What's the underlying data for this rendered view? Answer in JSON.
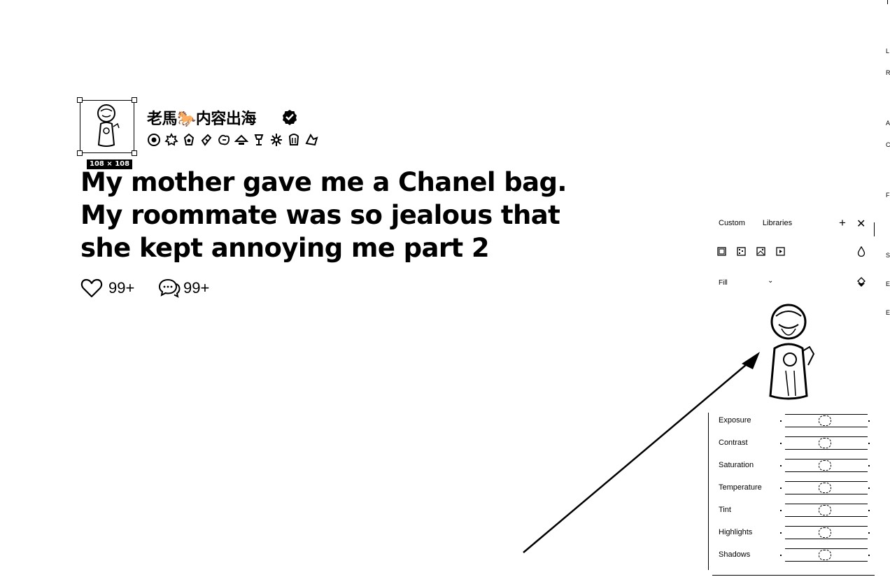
{
  "post": {
    "author_name": "老馬🐎内容出海",
    "size_badge": "108 × 108",
    "title": "My mother gave me a Chanel bag. My roommate was so jealous that she kept annoying me part 2",
    "likes": "99+",
    "comments": "99+"
  },
  "panel": {
    "tabs": [
      "Custom",
      "Libraries"
    ],
    "fill_label": "Fill",
    "adjustments": [
      "Exposure",
      "Contrast",
      "Saturation",
      "Temperature",
      "Tint",
      "Highlights",
      "Shadows"
    ]
  },
  "edge_letters": [
    "L",
    "R",
    "A",
    "C",
    "F",
    "S",
    "E",
    "E"
  ],
  "icons": {
    "verified": "verified-check-icon",
    "like": "heart-icon",
    "comment": "chat-bubble-icon",
    "add": "plus-icon",
    "close": "close-icon"
  }
}
